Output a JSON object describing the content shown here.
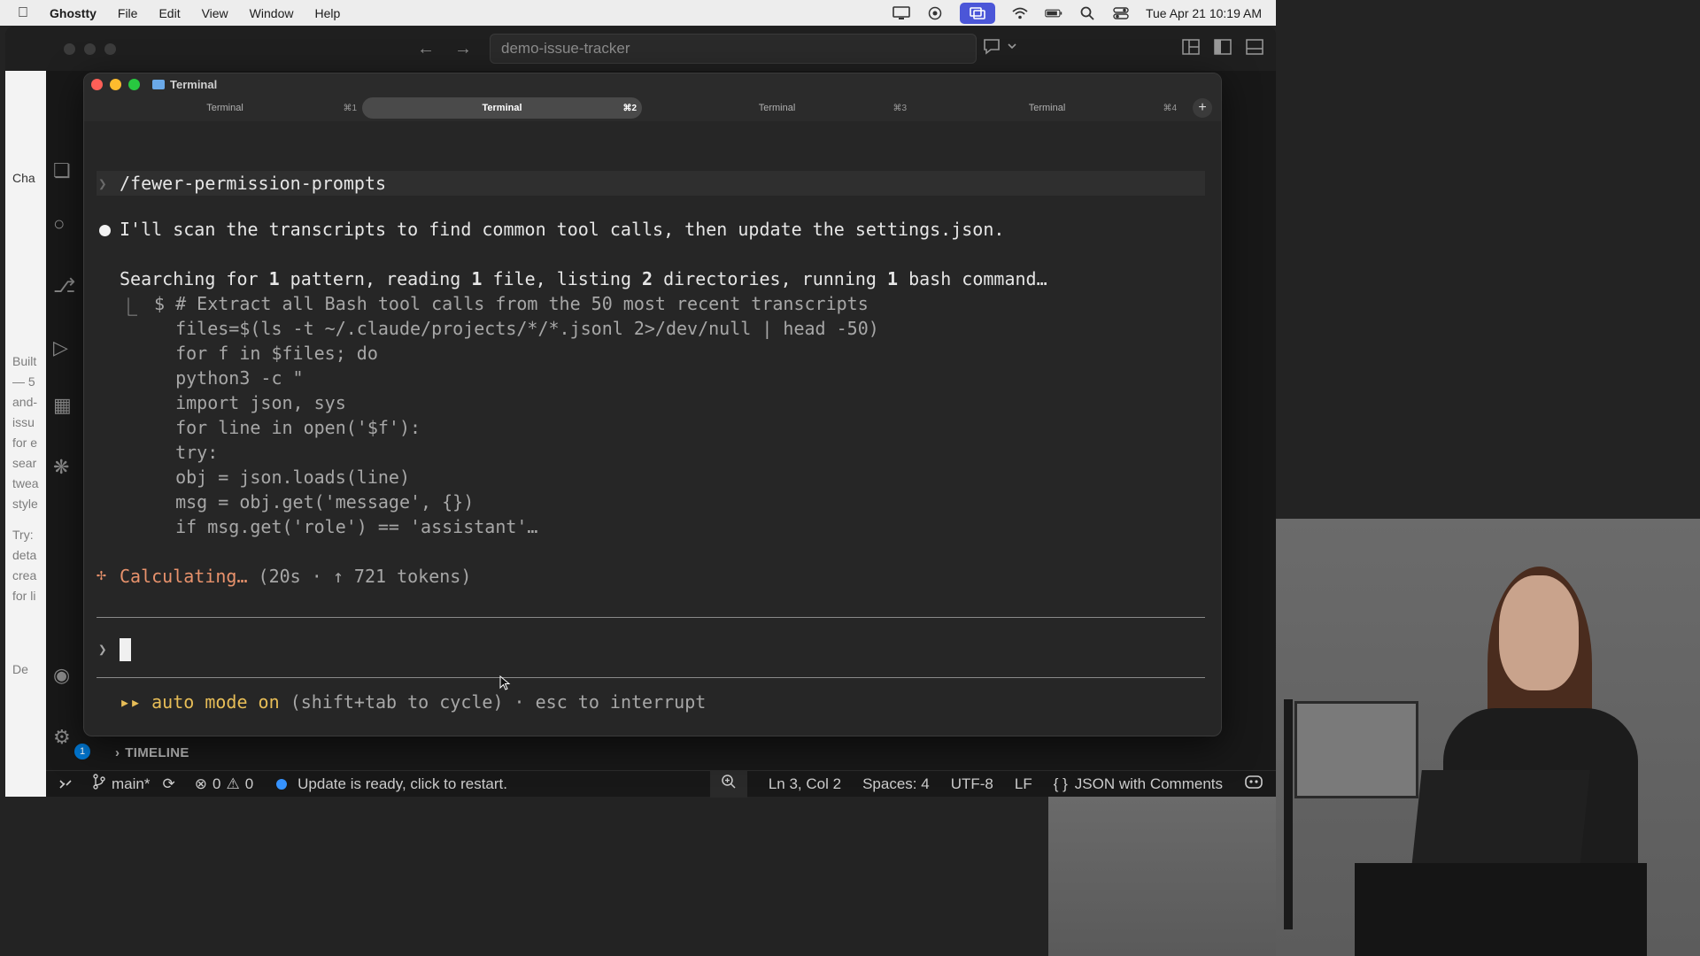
{
  "menubar": {
    "app": "Ghostty",
    "items": [
      "File",
      "Edit",
      "View",
      "Window",
      "Help"
    ],
    "datetime": "Tue Apr 21  10:19 AM"
  },
  "vscode": {
    "search_title": "demo-issue-tracker",
    "sidebar_text": [
      "Cha",
      "Built",
      "— 5",
      "and-",
      "issu",
      "for e",
      "sear",
      "twea",
      "style",
      "Try:",
      "deta",
      "crea",
      "for li",
      "De"
    ],
    "timeline_label": "TIMELINE",
    "status": {
      "branch": "main*",
      "errors": "0",
      "warnings": "0",
      "update_msg": "Update is ready, click to restart.",
      "position": "Ln 3, Col 2",
      "spaces": "Spaces: 4",
      "encoding": "UTF-8",
      "eol": "LF",
      "language_braces": "{ }",
      "language": "JSON with Comments",
      "badge_count": "1"
    }
  },
  "terminal": {
    "window_title": "Terminal",
    "tabs": [
      {
        "label": "Terminal",
        "key": "⌘1",
        "active": false
      },
      {
        "label": "Terminal",
        "key": "⌘2",
        "active": true
      },
      {
        "label": "Terminal",
        "key": "⌘3",
        "active": false
      },
      {
        "label": "Terminal",
        "key": "⌘4",
        "active": false
      }
    ],
    "plus": "+",
    "prompt_glyph": "❯",
    "command": "/fewer-permission-prompts",
    "message": "I'll scan the transcripts to find common tool calls, then update the settings.json.",
    "searching_prefix": "Searching for ",
    "searching_parts": [
      "1",
      " pattern, reading ",
      "1",
      " file, listing ",
      "2",
      " directories, running ",
      "1",
      " bash command…"
    ],
    "corner_glyph": "⎿",
    "code_lines": [
      "$ # Extract all Bash tool calls from the 50 most recent transcripts",
      "  files=$(ls -t ~/.claude/projects/*/*.jsonl 2>/dev/null | head -50)",
      "  for f in $files; do",
      "  python3 -c \"",
      "  import json, sys",
      "  for line in open('$f'):",
      "  try:",
      "  obj = json.loads(line)",
      "  msg = obj.get('message', {})",
      "  if msg.get('role') == 'assistant'…"
    ],
    "spinner_glyph": "✢",
    "calculating": "Calculating…",
    "calc_stats": "(20s · ↑ 721 tokens)",
    "mode_glyph": "▸▸",
    "mode_label": "auto mode on",
    "mode_hint": "(shift+tab to cycle) · esc to interrupt"
  }
}
